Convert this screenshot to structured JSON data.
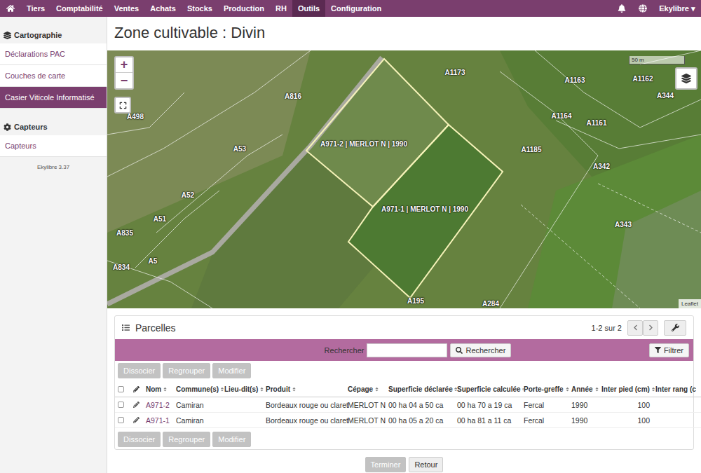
{
  "navbar": {
    "items": [
      {
        "label": "Tiers",
        "selected": false
      },
      {
        "label": "Comptabilité",
        "selected": false
      },
      {
        "label": "Ventes",
        "selected": false
      },
      {
        "label": "Achats",
        "selected": false
      },
      {
        "label": "Stocks",
        "selected": false
      },
      {
        "label": "Production",
        "selected": false
      },
      {
        "label": "RH",
        "selected": false
      },
      {
        "label": "Outils",
        "selected": true
      },
      {
        "label": "Configuration",
        "selected": false
      }
    ],
    "user": "Ekylibre",
    "caret": "▾"
  },
  "sidebar": {
    "sections": [
      {
        "title": "Cartographie",
        "items": [
          {
            "label": "Déclarations PAC",
            "selected": false
          },
          {
            "label": "Couches de carte",
            "selected": false
          },
          {
            "label": "Casier Viticole Informatisé",
            "selected": true
          }
        ]
      },
      {
        "title": "Capteurs",
        "items": [
          {
            "label": "Capteurs",
            "selected": false
          }
        ]
      }
    ],
    "version": "Ekylibre 3.37"
  },
  "page": {
    "title": "Zone cultivable : Divin"
  },
  "map": {
    "zoom_in": "+",
    "zoom_out": "−",
    "scale": "50 m",
    "attribution": "Leaflet",
    "labels": [
      "A1173",
      "A816",
      "A498",
      "A53",
      "A52",
      "A51",
      "A835",
      "A834",
      "A5",
      "A1163",
      "A1162",
      "A344",
      "A1164",
      "A1161",
      "A1185",
      "A342",
      "A343",
      "A195",
      "A284"
    ],
    "parcels": [
      {
        "label": "A971-2 | MERLOT N | 1990",
        "highlighted": true
      },
      {
        "label": "A971-1 | MERLOT N | 1990",
        "highlighted": true
      }
    ]
  },
  "panel": {
    "title": "Parcelles",
    "pagination": "1-2 sur 2",
    "search": {
      "label": "Rechercher",
      "value": "",
      "button": "Rechercher"
    },
    "filter": "Filtrer",
    "actions": [
      {
        "label": "Dissocier",
        "disabled": true
      },
      {
        "label": "Regrouper",
        "disabled": true
      },
      {
        "label": "Modifier",
        "disabled": true
      }
    ],
    "columns": [
      {
        "label": "Nom",
        "kind": "link"
      },
      {
        "label": "Commune(s)",
        "kind": "text"
      },
      {
        "label": "Lieu-dit(s)",
        "kind": "text"
      },
      {
        "label": "Produit",
        "kind": "text"
      },
      {
        "label": "Cépage",
        "kind": "text"
      },
      {
        "label": "Superficie déclarée",
        "kind": "text"
      },
      {
        "label": "Superficie calculée",
        "kind": "text"
      },
      {
        "label": "Porte-greffe",
        "kind": "text"
      },
      {
        "label": "Année",
        "kind": "text"
      },
      {
        "label": "Inter pied (cm)",
        "kind": "number"
      },
      {
        "label": "Inter rang (c",
        "kind": "number"
      }
    ],
    "rows": [
      {
        "selected": false,
        "cells": [
          "A971-2",
          "Camiran",
          "",
          "Bordeaux rouge ou claret",
          "MERLOT N",
          "00 ha 04 a 50 ca",
          "00 ha 70 a 19 ca",
          "Fercal",
          "1990",
          "100",
          ""
        ]
      },
      {
        "selected": false,
        "cells": [
          "A971-1",
          "Camiran",
          "",
          "Bordeaux rouge ou claret",
          "MERLOT N",
          "00 ha 05 a 20 ca",
          "00 ha 81 a 11 ca",
          "Fercal",
          "1990",
          "100",
          ""
        ]
      }
    ]
  },
  "buttons": [
    {
      "label": "Terminer",
      "disabled": true
    },
    {
      "label": "Retour",
      "disabled": false
    }
  ]
}
